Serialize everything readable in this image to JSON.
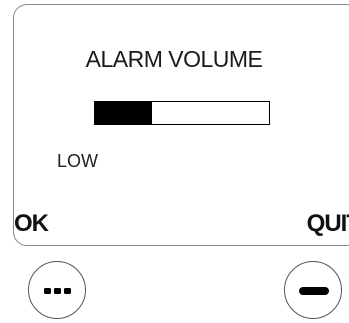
{
  "screen": {
    "title": "ALARM VOLUME",
    "volume_level": 0.33,
    "level_label": "LOW"
  },
  "softkeys": {
    "left_label": "OK",
    "right_label": "QUIT"
  },
  "buttons": {
    "left_icon": "dashes-icon",
    "right_icon": "minus-icon"
  }
}
